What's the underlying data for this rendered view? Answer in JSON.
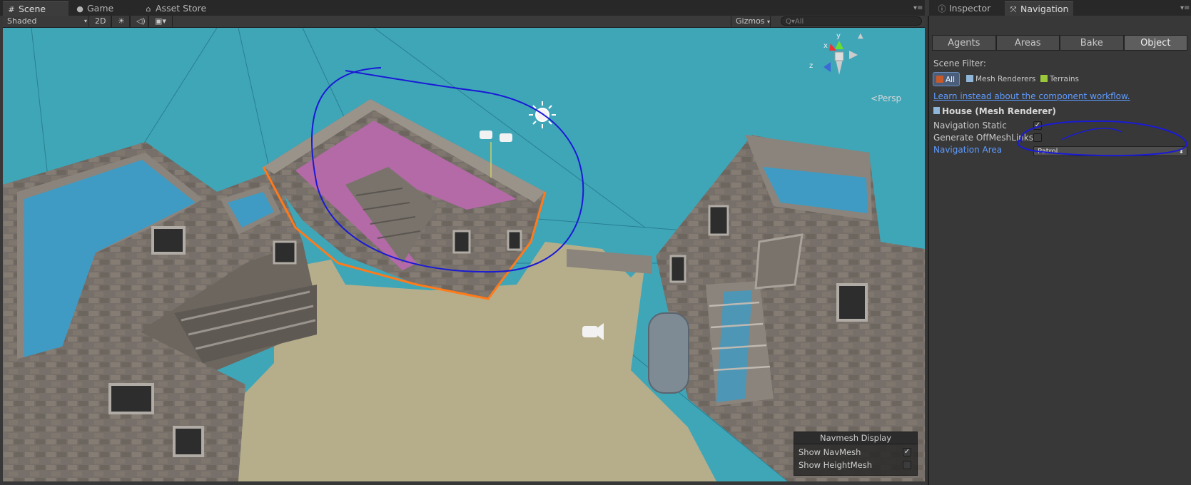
{
  "left_tabs": [
    {
      "label": "Scene",
      "icon": "grid-icon",
      "active": true
    },
    {
      "label": "Game",
      "icon": "pacman-icon",
      "active": false
    },
    {
      "label": "Asset Store",
      "icon": "shopping-bag-icon",
      "active": false
    }
  ],
  "right_tabs": [
    {
      "label": "Inspector",
      "icon": "info-icon",
      "active": false
    },
    {
      "label": "Navigation",
      "icon": "navigation-icon",
      "active": true
    }
  ],
  "toolbar": {
    "shading": "Shaded",
    "mode_2d": "2D",
    "gizmos": "Gizmos",
    "search_placeholder": "Q▾All"
  },
  "scene": {
    "projection": "Persp",
    "axes": {
      "x": "x",
      "y": "y",
      "z": "z"
    }
  },
  "navmesh_display": {
    "title": "Navmesh Display",
    "show_navmesh": {
      "label": "Show NavMesh",
      "checked": true
    },
    "show_heightmesh": {
      "label": "Show HeightMesh",
      "checked": false
    }
  },
  "navigation": {
    "tabs": [
      "Agents",
      "Areas",
      "Bake",
      "Object"
    ],
    "active_tab": "Object",
    "scene_filter_label": "Scene Filter:",
    "filters": [
      {
        "label": "All",
        "active": true
      },
      {
        "label": "Mesh Renderers",
        "active": false
      },
      {
        "label": "Terrains",
        "active": false
      }
    ],
    "workflow_link": "Learn instead about the component workflow.",
    "object_title": "House (Mesh Renderer)",
    "navigation_static": {
      "label": "Navigation Static",
      "checked": true
    },
    "generate_offmeshlinks": {
      "label": "Generate OffMeshLinks",
      "checked": false
    },
    "navigation_area": {
      "label": "Navigation Area",
      "value": "Patrol"
    }
  },
  "colors": {
    "navmesh": "#3fa6b8",
    "annotation": "#1a1ad6",
    "selection": "#ff7a1a",
    "link": "#5f9bff"
  }
}
